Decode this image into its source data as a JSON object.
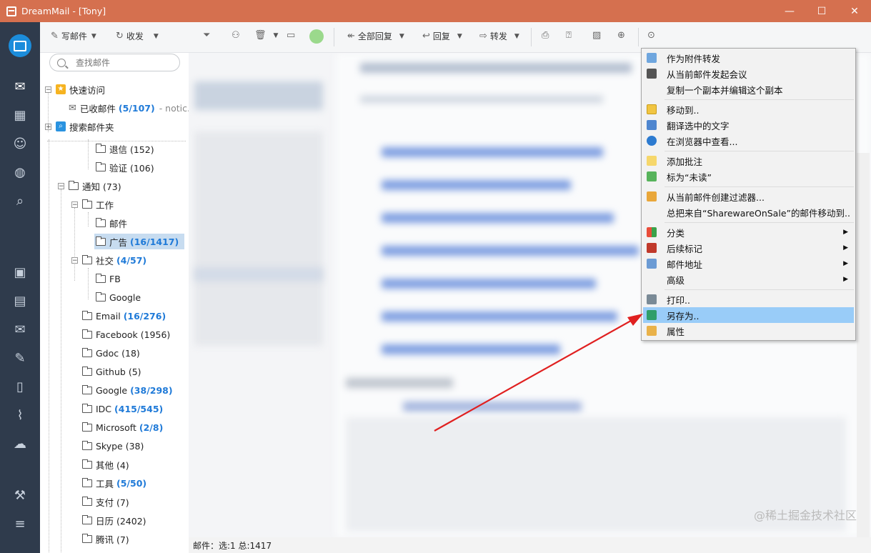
{
  "window": {
    "title": "DreamMail - [Tony]",
    "min_glyph": "—",
    "max_glyph": "☐",
    "close_glyph": "✕"
  },
  "toolbar": {
    "compose": "写邮件",
    "receive": "收发",
    "reply_all": "全部回复",
    "reply": "回复",
    "forward": "转发"
  },
  "search": {
    "placeholder": "查找邮件"
  },
  "folders": {
    "quick_access": "快速访问",
    "inbox": "已收邮件",
    "inbox_count": "(5/107)",
    "inbox_suffix": "- notic...",
    "search_folder": "搜索邮件夹",
    "bounce": "退信 (152)",
    "verify": "验证 (106)",
    "notice": "通知 (73)",
    "work": "工作",
    "mail": "邮件",
    "ads": "广告",
    "ads_count": "(16/1417)",
    "social": "社交",
    "social_count": "(4/57)",
    "fb": "FB",
    "google_sub": "Google",
    "email": "Email",
    "email_count": "(16/276)",
    "facebook": "Facebook (1956)",
    "gdoc": "Gdoc (18)",
    "github": "Github (5)",
    "google": "Google",
    "google_count": "(38/298)",
    "idc": "IDC",
    "idc_count": "(415/545)",
    "microsoft": "Microsoft",
    "microsoft_count": "(2/8)",
    "skype": "Skype (38)",
    "other": "其他 (4)",
    "tools": "工具",
    "tools_count": "(5/50)",
    "pay": "支付 (7)",
    "calendar": "日历 (2402)",
    "tencent": "腾讯 (7)"
  },
  "status": {
    "text": "邮件：选:1 总:1417"
  },
  "watermark": "@稀土掘金技术社区",
  "context_menu": {
    "forward_as_attachment": "作为附件转发",
    "start_meeting": "从当前邮件发起会议",
    "copy_and_edit": "复制一个副本并编辑这个副本",
    "move_to": "移动到..",
    "translate": "翻译选中的文字",
    "view_in_browser": "在浏览器中查看...",
    "add_note": "添加批注",
    "mark_unread": "标为“未读”",
    "create_filter": "从当前邮件创建过滤器...",
    "move_all_from": "总把来自“SharewareOnSale”的邮件移动到..",
    "category": "分类",
    "follow_up": "后续标记",
    "mail_address": "邮件地址",
    "advanced": "高级",
    "print": "打印..",
    "save_as": "另存为..",
    "properties": "属性",
    "submenu_arrow": "▶"
  }
}
